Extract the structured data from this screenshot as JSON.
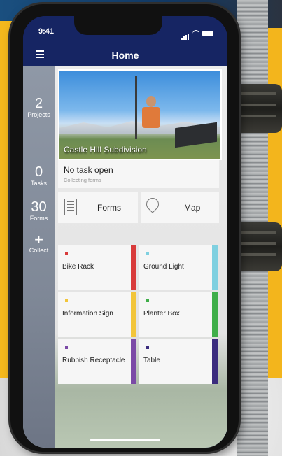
{
  "status": {
    "time": "9:41"
  },
  "header": {
    "title": "Home"
  },
  "sidebar": {
    "projects": {
      "count": "2",
      "label": "Projects"
    },
    "tasks": {
      "count": "0",
      "label": "Tasks"
    },
    "forms": {
      "count": "30",
      "label": "Forms"
    },
    "collect": {
      "symbol": "+",
      "label": "Collect"
    }
  },
  "project": {
    "name": "Castle Hill Subdivision"
  },
  "task": {
    "title": "No task open",
    "subtitle": "Collecting forms"
  },
  "buttons": {
    "forms": "Forms",
    "map": "Map"
  },
  "forms_grid": [
    {
      "label": "Bike Rack",
      "color": "#d83a3a"
    },
    {
      "label": "Ground Light",
      "color": "#7fd0e0"
    },
    {
      "label": "Information Sign",
      "color": "#f2c53a"
    },
    {
      "label": "Planter Box",
      "color": "#3fae49"
    },
    {
      "label": "Rubbish Receptacle",
      "color": "#7b4aa6"
    },
    {
      "label": "Table",
      "color": "#3b2c7e"
    }
  ],
  "colors": {
    "header": "#162563",
    "sidebar": "#8590a0"
  }
}
